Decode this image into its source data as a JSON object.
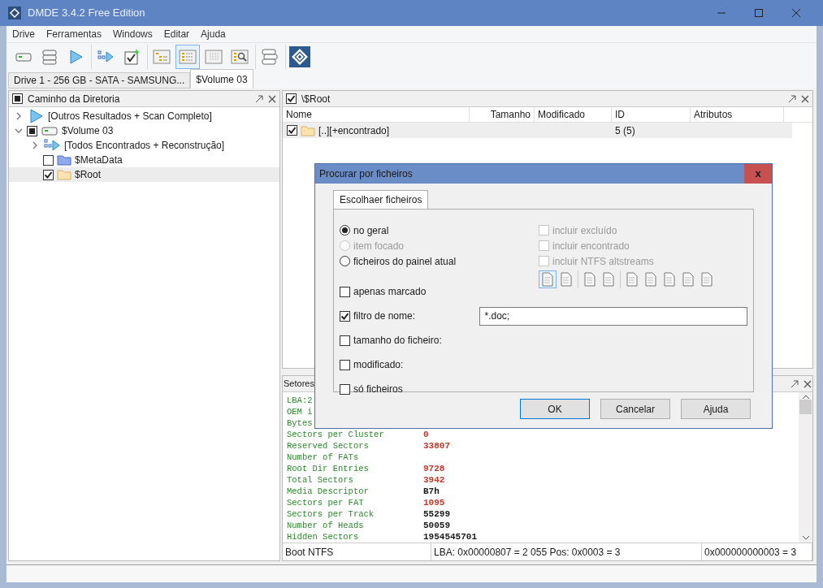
{
  "window": {
    "title": "DMDE 3.4.2 Free Edition"
  },
  "menu": [
    "Drive",
    "Ferramentas",
    "Windows",
    "Editar",
    "Ajuda"
  ],
  "toolbar": [
    [
      {
        "kind": "drive",
        "selected": false
      },
      {
        "kind": "drives",
        "selected": false
      },
      {
        "kind": "play",
        "selected": false
      }
    ],
    [
      {
        "kind": "scan",
        "selected": false
      },
      {
        "kind": "check",
        "selected": false
      }
    ],
    [
      {
        "kind": "tree",
        "selected": false
      },
      {
        "kind": "list",
        "selected": true
      },
      {
        "kind": "grid",
        "selected": false
      },
      {
        "kind": "search",
        "selected": false
      }
    ],
    [
      {
        "kind": "panels",
        "selected": false
      }
    ],
    [
      {
        "kind": "logo",
        "selected": false
      }
    ]
  ],
  "tabs": [
    {
      "label": "Drive 1 - 256 GB - SATA - SAMSUNG...",
      "selected": false
    },
    {
      "label": "$Volume 03",
      "selected": true
    }
  ],
  "tree_panel": {
    "title": "Caminho da Diretoria",
    "checked": false,
    "mixed": true,
    "items": [
      {
        "label": "[Outros Resultados + Scan Completo]",
        "kind": "play",
        "expanded": false,
        "selected": false
      },
      {
        "label": "$Volume 03",
        "kind": "drive",
        "checked": false,
        "mixed": true,
        "expanded": true,
        "selected": false,
        "children": [
          {
            "label": "[Todos Encontrados + Reconstrução]",
            "kind": "scan",
            "expanded": false,
            "selected": false
          },
          {
            "label": "$MetaData",
            "kind": "metadata-folder",
            "checked": false,
            "mixed": false,
            "selected": false
          },
          {
            "label": "$Root",
            "kind": "folder",
            "checked": true,
            "mixed": false,
            "selected": true
          }
        ]
      }
    ]
  },
  "files_panel": {
    "title": "\\$Root",
    "checked": true,
    "columns": [
      "Nome",
      "Tamanho",
      "Modificado",
      "ID",
      "Atributos"
    ],
    "rows": [
      {
        "checked": true,
        "name": "[..][+encontrado]",
        "id": "5 (5)",
        "selected": true
      }
    ]
  },
  "sectors_panel": {
    "title": "Setores",
    "lines": [
      {
        "label": "LBA:2"
      },
      {
        "label": "OEM i"
      },
      {
        "label": "Bytes"
      },
      {
        "label": "Sectors per Cluster",
        "value": "0",
        "color": "#c0392b"
      },
      {
        "label": "Reserved Sectors",
        "value": "33807",
        "color": "#c0392b"
      },
      {
        "label": "Number of FATs"
      },
      {
        "label": "Root Dir Entries",
        "value": "9728",
        "color": "#c0392b"
      },
      {
        "label": "Total Sectors",
        "value": "3942",
        "color": "#c0392b"
      },
      {
        "label": "Media Descriptor",
        "value": "B7h",
        "color": "#1a1a1a"
      },
      {
        "label": "Sectors per FAT",
        "value": "1095",
        "color": "#c0392b"
      },
      {
        "label": "Sectors per Track",
        "value": "55299",
        "color": "#1a1a1a"
      },
      {
        "label": "Number of Heads",
        "value": "50059",
        "color": "#1a1a1a"
      },
      {
        "label": "Hidden Sectors",
        "value": "1954545701",
        "color": "#1a1a1a"
      }
    ],
    "status": [
      "Boot NTFS",
      "LBA: 0x00000807 = 2 055  Pos: 0x0003 = 3",
      "0x000000000003 = 3"
    ]
  },
  "dialog": {
    "title": "Procurar por ficheiros",
    "close": "x",
    "tab": {
      "label": "Escolhaer ficheiros",
      "selected": true
    },
    "scope": [
      {
        "label": "no geral",
        "selected": true,
        "disabled": false
      },
      {
        "label": "item focado",
        "selected": false,
        "disabled": true
      },
      {
        "label": "ficheiros do painel atual",
        "selected": false,
        "disabled": false
      }
    ],
    "include": [
      {
        "label": "incluir excluído",
        "checked": false,
        "disabled": true
      },
      {
        "label": "incluir encontrado",
        "checked": false,
        "disabled": true
      },
      {
        "label": "incluir NTFS altstreams",
        "checked": false,
        "disabled": true
      }
    ],
    "filter_tools": [
      [
        {
          "selected": true
        },
        {
          "selected": false
        }
      ],
      [
        {
          "selected": false
        },
        {
          "selected": false
        }
      ],
      [
        {
          "selected": false
        },
        {
          "selected": false
        },
        {
          "selected": false
        },
        {
          "selected": false
        },
        {
          "selected": false
        }
      ]
    ],
    "options": [
      {
        "label": "apenas marcado",
        "checked": false
      },
      {
        "label": "filtro de nome:",
        "checked": true,
        "value": "*.doc;"
      },
      {
        "label": "tamanho do ficheiro:",
        "checked": false
      },
      {
        "label": "modificado:",
        "checked": false
      },
      {
        "label": "só ficheiros",
        "checked": false
      }
    ],
    "buttons": [
      {
        "label": "OK",
        "default": true
      },
      {
        "label": "Cancelar",
        "default": false
      },
      {
        "label": "Ajuda",
        "default": false
      }
    ]
  }
}
